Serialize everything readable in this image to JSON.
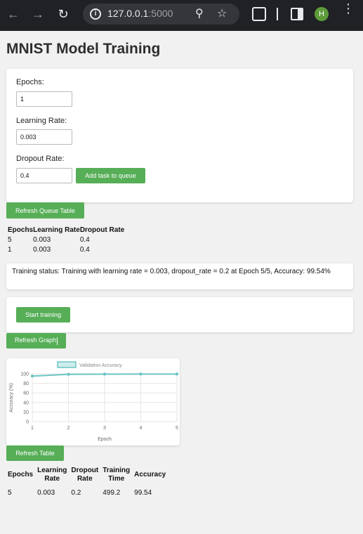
{
  "browser": {
    "url_host": "127.0.0.1",
    "url_port": ":5000",
    "avatar_letter": "H"
  },
  "page": {
    "title": "MNIST Model Training"
  },
  "form": {
    "epochs_label": "Epochs:",
    "epochs_value": "1",
    "learning_rate_label": "Learning Rate:",
    "learning_rate_value": "0.003",
    "dropout_label": "Dropout Rate:",
    "dropout_value": "0.4",
    "add_task_label": "Add task to queue"
  },
  "queue": {
    "refresh_label": "Refresh Queue Table",
    "headers": [
      "Epochs",
      "Learning Rate",
      "Dropout Rate"
    ],
    "rows": [
      [
        "5",
        "0.003",
        "0.4"
      ],
      [
        "1",
        "0.003",
        "0.4"
      ]
    ]
  },
  "status": {
    "text": "Training status: Training with learning rate = 0.003, dropout_rate = 0.2 at Epoch 5/5, Accuracy: 99.54%"
  },
  "training": {
    "start_label": "Start training",
    "refresh_graph_label": "Refresh Graph"
  },
  "chart_data": {
    "type": "line",
    "x": [
      1,
      2,
      3,
      4,
      5
    ],
    "series": [
      {
        "name": "Validation Accuracy",
        "values": [
          95.3,
          98.9,
          99.3,
          99.5,
          99.54
        ],
        "color": "#6cc5c4"
      }
    ],
    "xlabel": "Epoch",
    "ylabel": "Accuracy (%)",
    "ylim": [
      0,
      100
    ],
    "yticks": [
      0,
      20,
      40,
      60,
      80,
      100
    ],
    "xticks": [
      1,
      2,
      3,
      4,
      5
    ],
    "legend": "top",
    "grid": true
  },
  "results": {
    "refresh_label": "Refresh Table",
    "headers": [
      [
        "Epochs"
      ],
      [
        "Learning",
        "Rate"
      ],
      [
        "Dropout",
        "Rate"
      ],
      [
        "Training",
        "Time"
      ],
      [
        "Accuracy"
      ]
    ],
    "rows": [
      [
        "5",
        "0.003",
        "0.2",
        "499.2",
        "99.54"
      ]
    ]
  }
}
